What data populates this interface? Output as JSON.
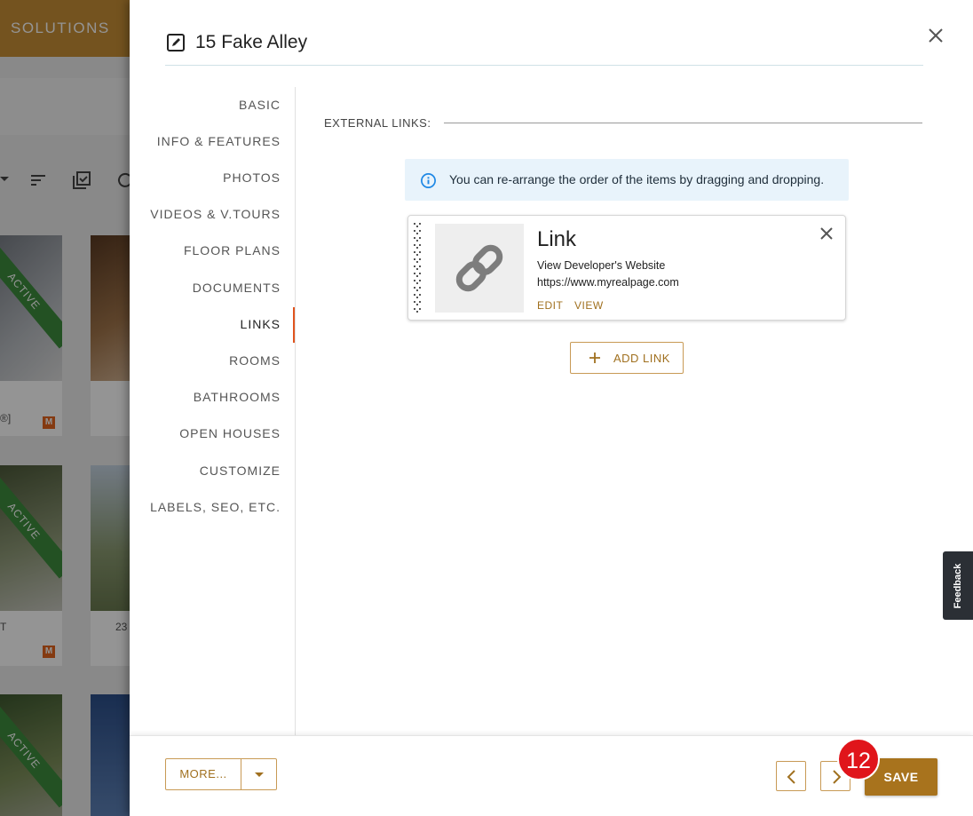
{
  "background": {
    "brand": "SOLUTIONS",
    "cards": [
      {
        "ribbon": "ACTIVE",
        "text": "®]",
        "badge": "M"
      },
      {
        "ribbon": "ACTIVE",
        "text": "T",
        "badge": "M"
      },
      {
        "ribbon": "ACTIVE",
        "text": "",
        "badge": ""
      }
    ],
    "card2_text": "23"
  },
  "dialog": {
    "title": "15 Fake Alley",
    "nav": [
      {
        "label": "BASIC",
        "active": false
      },
      {
        "label": "INFO & FEATURES",
        "active": false
      },
      {
        "label": "PHOTOS",
        "active": false
      },
      {
        "label": "VIDEOS & V.TOURS",
        "active": false
      },
      {
        "label": "FLOOR PLANS",
        "active": false
      },
      {
        "label": "DOCUMENTS",
        "active": false
      },
      {
        "label": "LINKS",
        "active": true
      },
      {
        "label": "ROOMS",
        "active": false
      },
      {
        "label": "BATHROOMS",
        "active": false
      },
      {
        "label": "OPEN HOUSES",
        "active": false
      },
      {
        "label": "CUSTOMIZE",
        "active": false
      },
      {
        "label": "LABELS, SEO, ETC.",
        "active": false
      }
    ],
    "section_label": "EXTERNAL LINKS:",
    "info_text": "You can re-arrange the order of the items by dragging and dropping.",
    "link_item": {
      "title": "Link",
      "description": "View Developer's Website",
      "url": "https://www.myrealpage.com",
      "edit_label": "EDIT",
      "view_label": "VIEW"
    },
    "add_link_label": "ADD LINK",
    "footer": {
      "more_label": "MORE...",
      "save_label": "SAVE",
      "step_badge": "12"
    }
  },
  "feedback_label": "Feedback",
  "colors": {
    "accent": "#a8731d",
    "active_nav_bar": "#e0541e",
    "info_bg": "#e8f3fb",
    "step_badge": "#e0151b"
  }
}
